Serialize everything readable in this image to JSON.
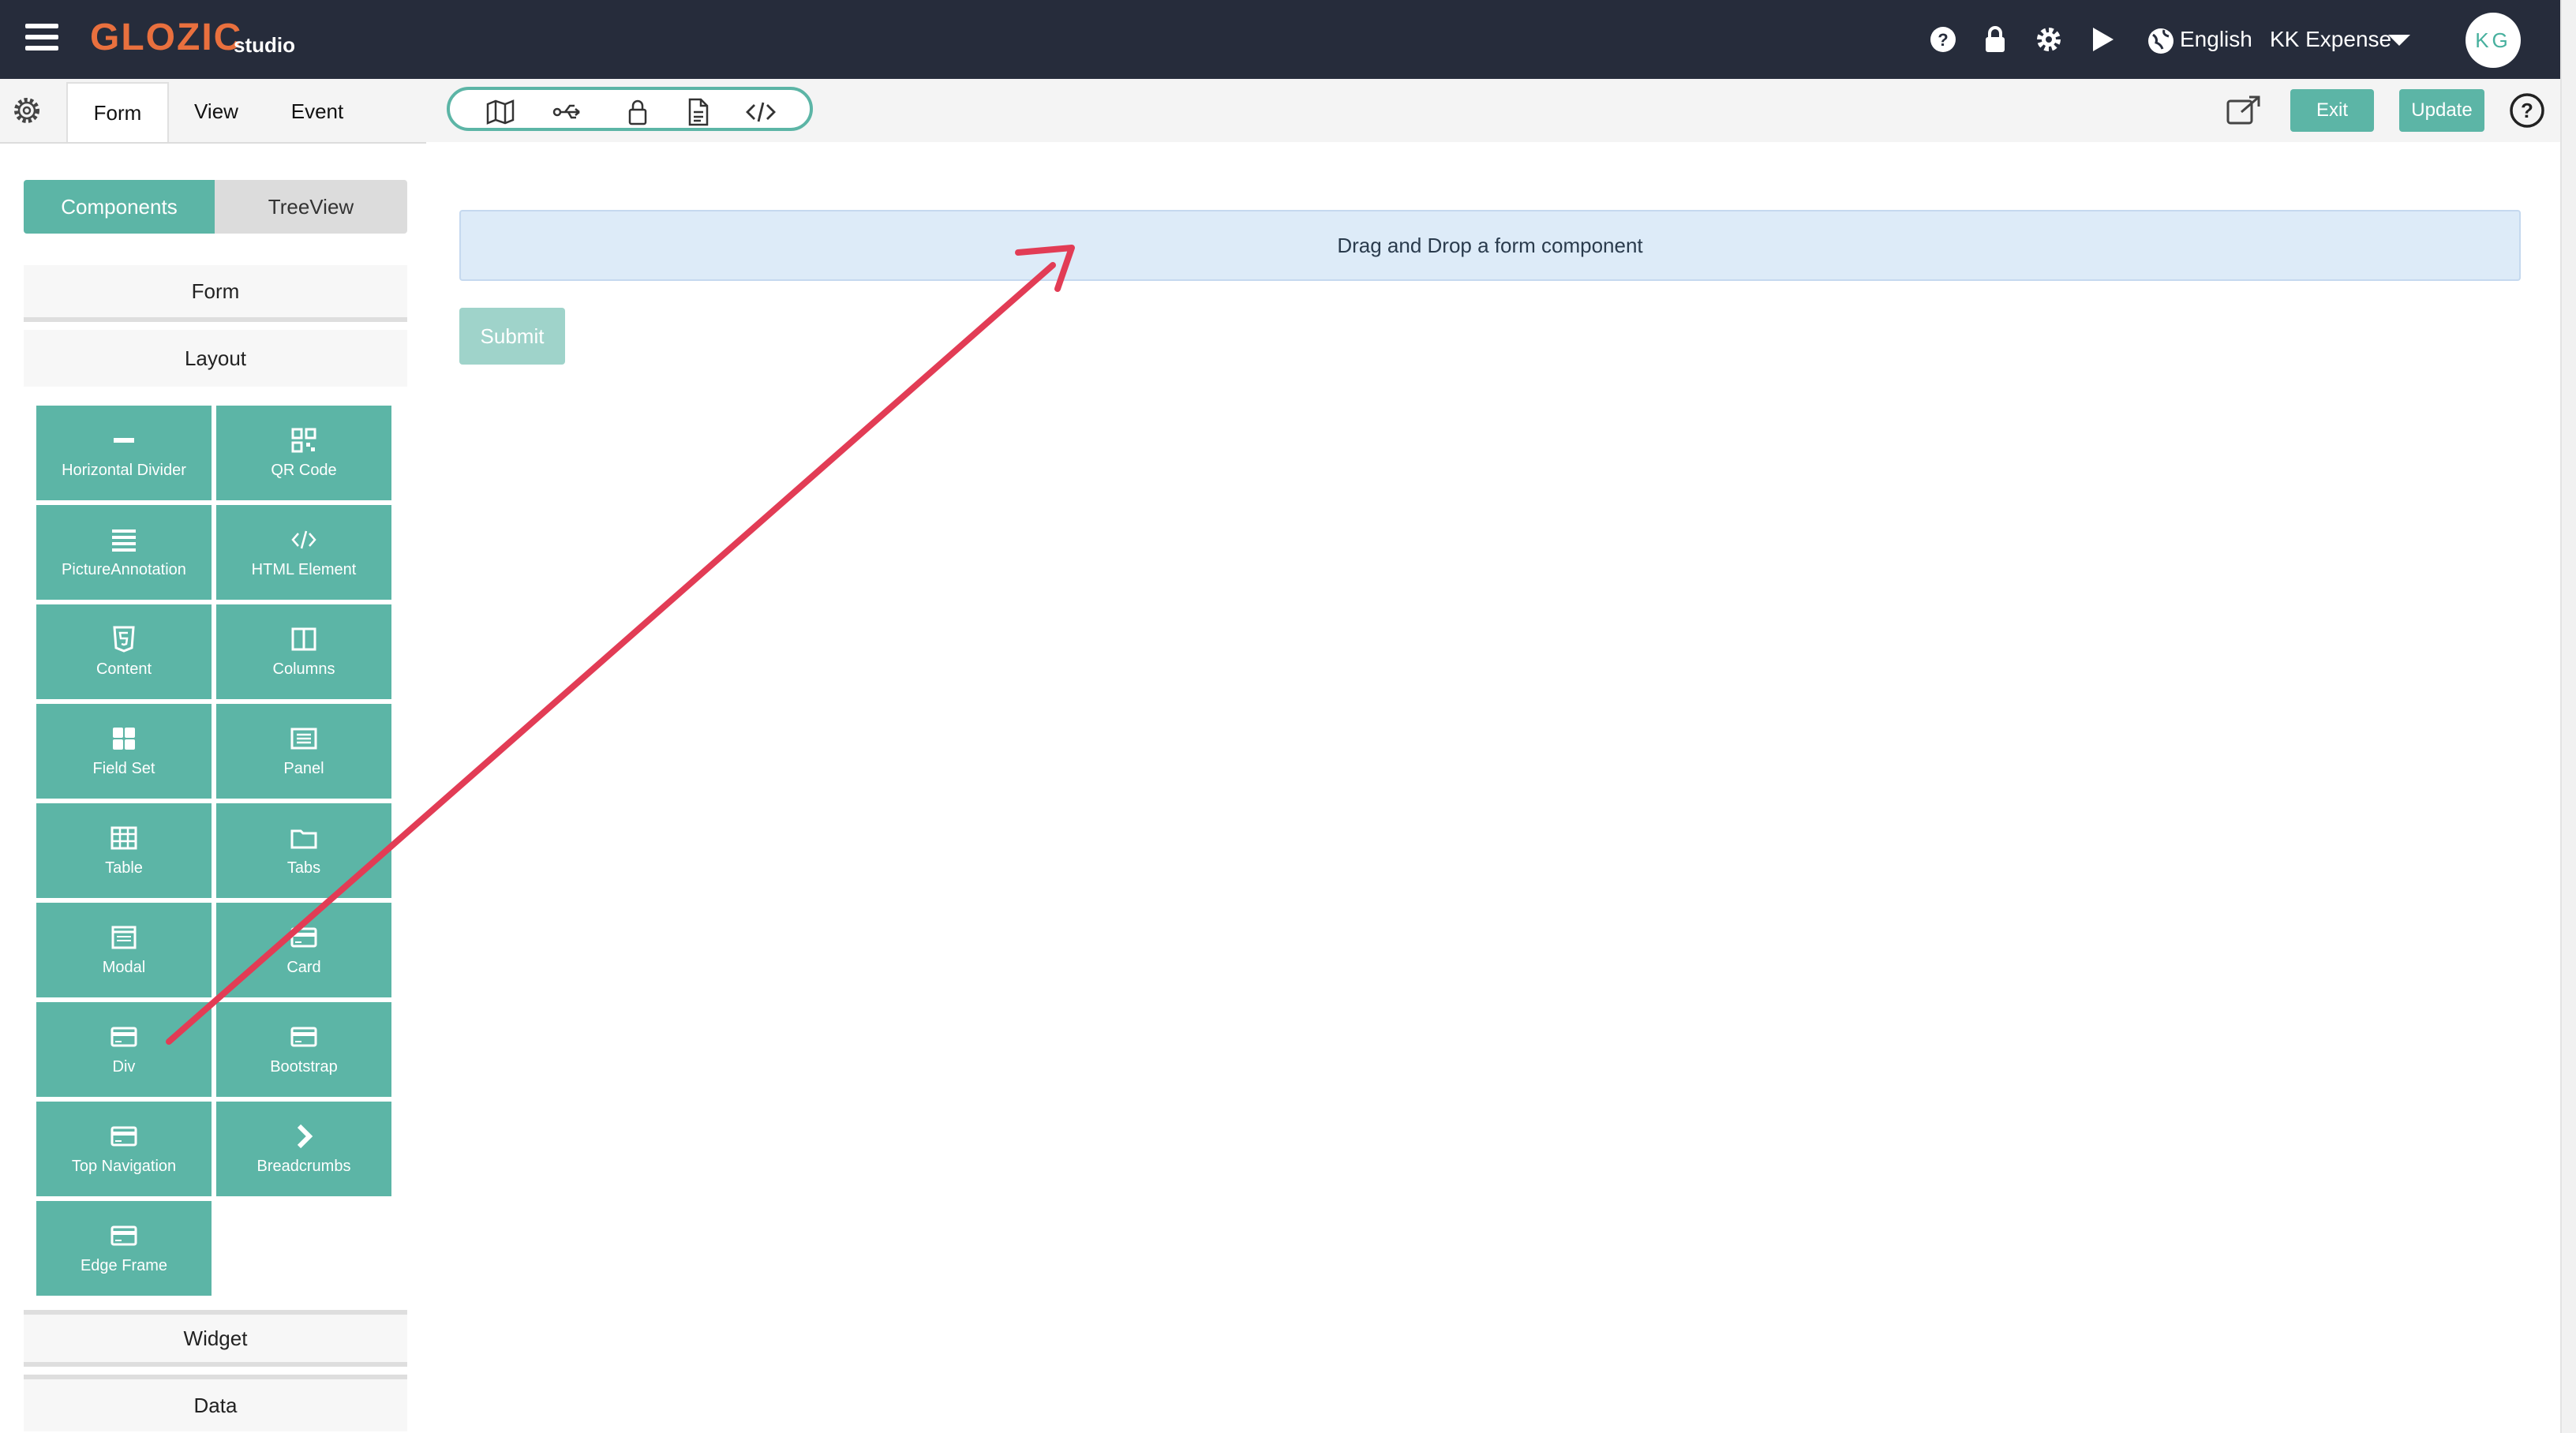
{
  "app": {
    "brand": "GLOZIC",
    "brand_sub": "studio",
    "language": "English",
    "project": "KK Expense",
    "avatar_initials": "KG"
  },
  "subbar": {
    "tabs": [
      {
        "label": "Form"
      },
      {
        "label": "View"
      },
      {
        "label": "Event"
      }
    ],
    "exit_label": "Exit",
    "update_label": "Update"
  },
  "sidebar": {
    "toggle": {
      "components": "Components",
      "treeview": "TreeView"
    },
    "sections": {
      "form": "Form",
      "layout": "Layout",
      "widget": "Widget",
      "data": "Data"
    },
    "components": [
      {
        "label": "Horizontal Divider",
        "icon": "minus-icon"
      },
      {
        "label": "QR Code",
        "icon": "qrcode-icon"
      },
      {
        "label": "PictureAnnotation",
        "icon": "list-icon"
      },
      {
        "label": "HTML Element",
        "icon": "code-icon"
      },
      {
        "label": "Content",
        "icon": "html5-icon"
      },
      {
        "label": "Columns",
        "icon": "columns-icon"
      },
      {
        "label": "Field Set",
        "icon": "th-large-icon"
      },
      {
        "label": "Panel",
        "icon": "list-alt-icon"
      },
      {
        "label": "Table",
        "icon": "table-icon"
      },
      {
        "label": "Tabs",
        "icon": "folder-icon"
      },
      {
        "label": "Modal",
        "icon": "modal-icon"
      },
      {
        "label": "Card",
        "icon": "credit-card-icon"
      },
      {
        "label": "Div",
        "icon": "credit-card-icon"
      },
      {
        "label": "Bootstrap",
        "icon": "credit-card-icon"
      },
      {
        "label": "Top Navigation",
        "icon": "credit-card-icon"
      },
      {
        "label": "Breadcrumbs",
        "icon": "chevron-right-icon"
      },
      {
        "label": "Edge Frame",
        "icon": "credit-card-icon"
      }
    ]
  },
  "canvas": {
    "dropzone_text": "Drag and Drop a form component",
    "submit_label": "Submit"
  },
  "colors": {
    "topbar": "#262c3b",
    "accent": "#5cb5a6",
    "brand": "#e9703e",
    "arrow": "#e23c55",
    "dropzone": "#ddebf8"
  }
}
